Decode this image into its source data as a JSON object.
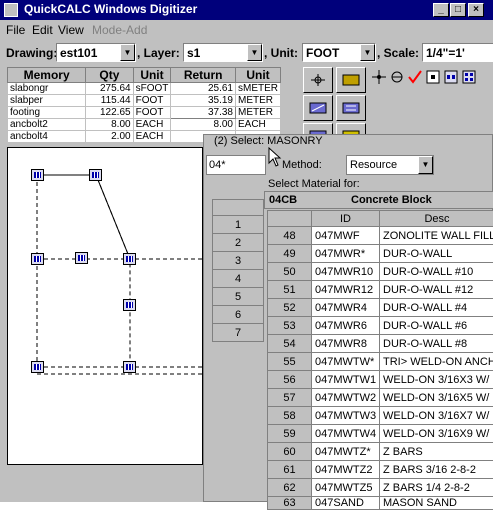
{
  "window": {
    "title": "QuickCALC Windows Digitizer",
    "min": "_",
    "max": "□",
    "close": "×"
  },
  "menu": {
    "file": "File",
    "edit": "Edit",
    "view": "View",
    "mode_add": "Mode-Add"
  },
  "toolbar": {
    "drawing_label": "Drawing:",
    "drawing_value": "est101",
    "layer_label": ", Layer:",
    "layer_value": "s1",
    "unit_label": ", Unit:",
    "unit_value": "FOOT",
    "scale_label": ", Scale:",
    "scale_value": "1/4\"=1'"
  },
  "memory": {
    "headers": [
      "Memory",
      "Qty",
      "Unit",
      "Return",
      "Unit"
    ],
    "rows": [
      [
        "slabongr",
        "275.64",
        "sFOOT",
        "25.61",
        "sMETER"
      ],
      [
        "slabper",
        "115.44",
        "FOOT",
        "35.19",
        "METER"
      ],
      [
        "footing",
        "122.65",
        "FOOT",
        "37.38",
        "METER"
      ],
      [
        "ancbolt2",
        "8.00",
        "EACH",
        "8.00",
        "EACH"
      ],
      [
        "ancbolt4",
        "2.00",
        "EACH",
        "",
        ""
      ]
    ]
  },
  "dialog": {
    "title": "(2) Select: MASONRY",
    "search_value": "04*",
    "method_label": "Method:",
    "method_value": "Resource",
    "select_label": "Select Material for:",
    "category_code": "04CB",
    "category_name": "Concrete Block",
    "left_rows": [
      "1",
      "2",
      "3",
      "4",
      "5",
      "6",
      "7"
    ],
    "columns": {
      "id": "ID",
      "desc": "Desc"
    },
    "rows": [
      [
        "48",
        "047MWF",
        "ZONOLITE WALL FILL"
      ],
      [
        "49",
        "047MWR*",
        "DUR-O-WALL"
      ],
      [
        "50",
        "047MWR10",
        "DUR-O-WALL #10"
      ],
      [
        "51",
        "047MWR12",
        "DUR-O-WALL #12"
      ],
      [
        "52",
        "047MWR4",
        "DUR-O-WALL #4"
      ],
      [
        "53",
        "047MWR6",
        "DUR-O-WALL #6"
      ],
      [
        "54",
        "047MWR8",
        "DUR-O-WALL #8"
      ],
      [
        "55",
        "047MWTW*",
        "TRI> WELD-ON ANCH"
      ],
      [
        "56",
        "047MWTW1",
        "WELD-ON 3/16X3 W/"
      ],
      [
        "57",
        "047MWTW2",
        "WELD-ON 3/16X5 W/"
      ],
      [
        "58",
        "047MWTW3",
        "WELD-ON 3/16X7 W/"
      ],
      [
        "59",
        "047MWTW4",
        "WELD-ON 3/16X9 W/"
      ],
      [
        "60",
        "047MWTZ*",
        "Z BARS"
      ],
      [
        "61",
        "047MWTZ2",
        "Z BARS 3/16 2-8-2"
      ],
      [
        "62",
        "047MWTZ5",
        "Z BARS 1/4 2-8-2"
      ],
      [
        "63",
        "047SAND",
        "MASON SAND"
      ]
    ]
  },
  "colors": {
    "titlebar": "#00007b",
    "face": "#c0c0c0",
    "accent_check": "#ff0000"
  }
}
